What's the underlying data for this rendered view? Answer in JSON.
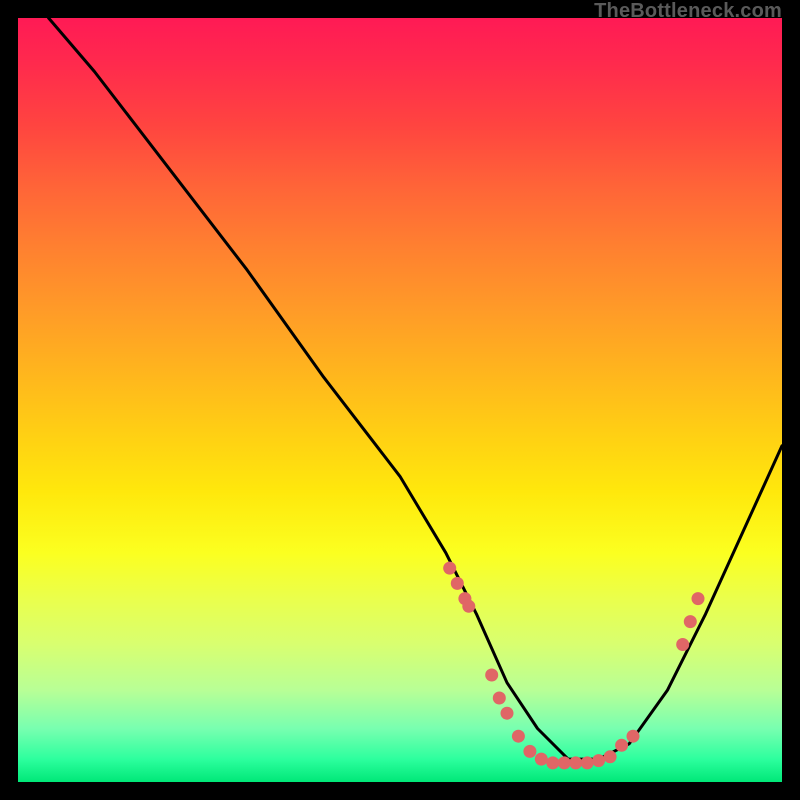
{
  "watermark": "TheBottleneck.com",
  "chart_data": {
    "type": "line",
    "title": "",
    "xlabel": "",
    "ylabel": "",
    "xlim": [
      0,
      100
    ],
    "ylim": [
      0,
      100
    ],
    "grid": false,
    "legend": false,
    "series": [
      {
        "name": "curve",
        "x": [
          4,
          10,
          20,
          30,
          40,
          50,
          56,
          60,
          64,
          68,
          72,
          76,
          80,
          85,
          90,
          95,
          100
        ],
        "y": [
          100,
          93,
          80,
          67,
          53,
          40,
          30,
          22,
          13,
          7,
          3,
          3,
          5,
          12,
          22,
          33,
          44
        ]
      }
    ],
    "markers": [
      {
        "x": 56.5,
        "y": 28
      },
      {
        "x": 57.5,
        "y": 26
      },
      {
        "x": 58.5,
        "y": 24
      },
      {
        "x": 59,
        "y": 23
      },
      {
        "x": 62,
        "y": 14
      },
      {
        "x": 63,
        "y": 11
      },
      {
        "x": 64,
        "y": 9
      },
      {
        "x": 65.5,
        "y": 6
      },
      {
        "x": 67,
        "y": 4
      },
      {
        "x": 68.5,
        "y": 3
      },
      {
        "x": 70,
        "y": 2.5
      },
      {
        "x": 71.5,
        "y": 2.5
      },
      {
        "x": 73,
        "y": 2.5
      },
      {
        "x": 74.5,
        "y": 2.5
      },
      {
        "x": 76,
        "y": 2.8
      },
      {
        "x": 77.5,
        "y": 3.3
      },
      {
        "x": 79,
        "y": 4.8
      },
      {
        "x": 80.5,
        "y": 6
      },
      {
        "x": 87,
        "y": 18
      },
      {
        "x": 88,
        "y": 21
      },
      {
        "x": 89,
        "y": 24
      }
    ]
  }
}
